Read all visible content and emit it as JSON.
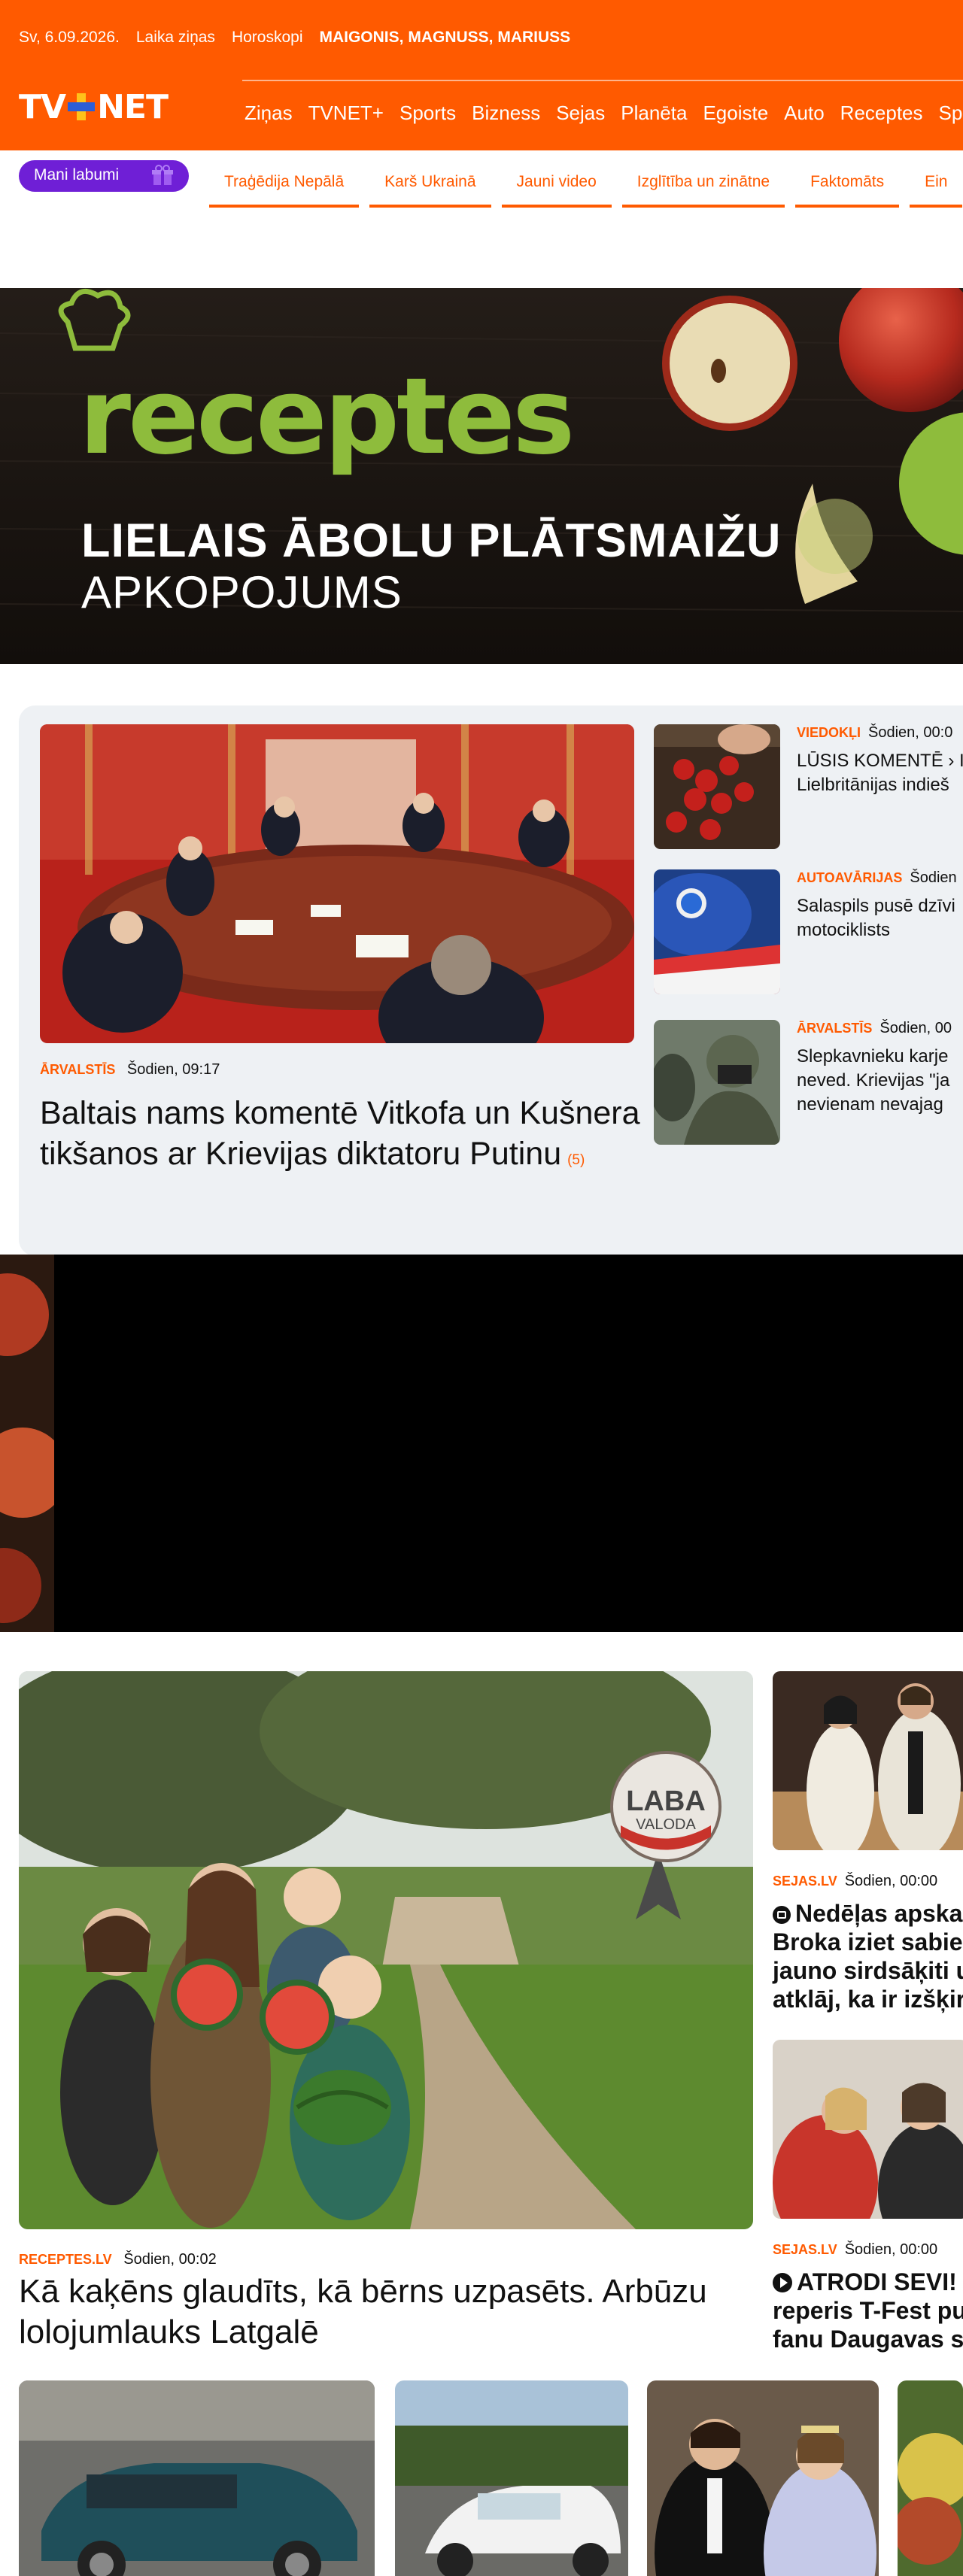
{
  "topbar": {
    "date": "Sv, 6.09.2026.",
    "weather": "Laika ziņas",
    "horoscope": "Horoskopi",
    "namedays": "MAIGONIS, MAGNUSS, MARIUSS"
  },
  "logo": {
    "left": "TV",
    "right": "NET"
  },
  "nav": [
    "Ziņas",
    "TVNET+",
    "Sports",
    "Bizness",
    "Sejas",
    "Planēta",
    "Egoiste",
    "Auto",
    "Receptes",
    "Spok"
  ],
  "mani_labumi": "Mani labumi",
  "subnav": [
    "Traģēdija Nepālā",
    "Karš Ukrainā",
    "Jauni video",
    "Izglītība un zinātne",
    "Faktomāts",
    "Ein"
  ],
  "banner": {
    "brand": "receptes",
    "line1": "LIELAIS ĀBOLU PLĀTSMAIŽU",
    "line2": "APKOPOJUMS"
  },
  "main_article": {
    "category": "ĀRVALSTĪS",
    "time": "Šodien, 09:17",
    "title": "Baltais nams komentē Vitkofa un Kušnera tikšanos ar Krievijas diktatoru Putinu",
    "comments": "(5)"
  },
  "side_articles": [
    {
      "category": "VIEDOKĻI",
      "time": "Šodien, 00:0",
      "title_line1": "LŪSIS KOMENTĒ › I",
      "title_line2": "Lielbritānijas indieš"
    },
    {
      "category": "AUTOAVĀRIJAS",
      "time": "Šodien",
      "title_line1": "Salaspils pusē dzīvi",
      "title_line2": "motociklists"
    },
    {
      "category": "ĀRVALSTĪS",
      "time": "Šodien, 00",
      "title_line1": "Slepkavnieku karje",
      "title_line2": "neved. Krievijas \"ja",
      "title_line3": "nevienam nevajag"
    }
  ],
  "featured": {
    "category": "RECEPTES.LV",
    "time": "Šodien, 00:02",
    "title": "Kā kaķēns glaudīts, kā bērns uzpasēts. Arbūzu lolojumlauks Latgalē",
    "badge_line1": "LABA",
    "badge_line2": "VALODA"
  },
  "right_articles": [
    {
      "category": "SEJAS.LV",
      "time": "Šodien, 00:00",
      "icon": "gallery-icon",
      "title_line1": "Nedēļas apska",
      "title_line2": "Broka iziet sabied",
      "title_line3": "jauno sirdsāķiti u",
      "title_line4": "atklāj, ka ir izšķiru"
    },
    {
      "category": "SEJAS.LV",
      "time": "Šodien, 00:00",
      "icon": "play-icon",
      "title_line1": "ATRODI SEVI!",
      "title_line2": "reperis T-Fest pulc",
      "title_line3": "fanu Daugavas st"
    }
  ],
  "colors": {
    "brand": "#ff5a00",
    "accent_purple": "#6f1fd6",
    "receptes_green": "#8ebc3c"
  }
}
